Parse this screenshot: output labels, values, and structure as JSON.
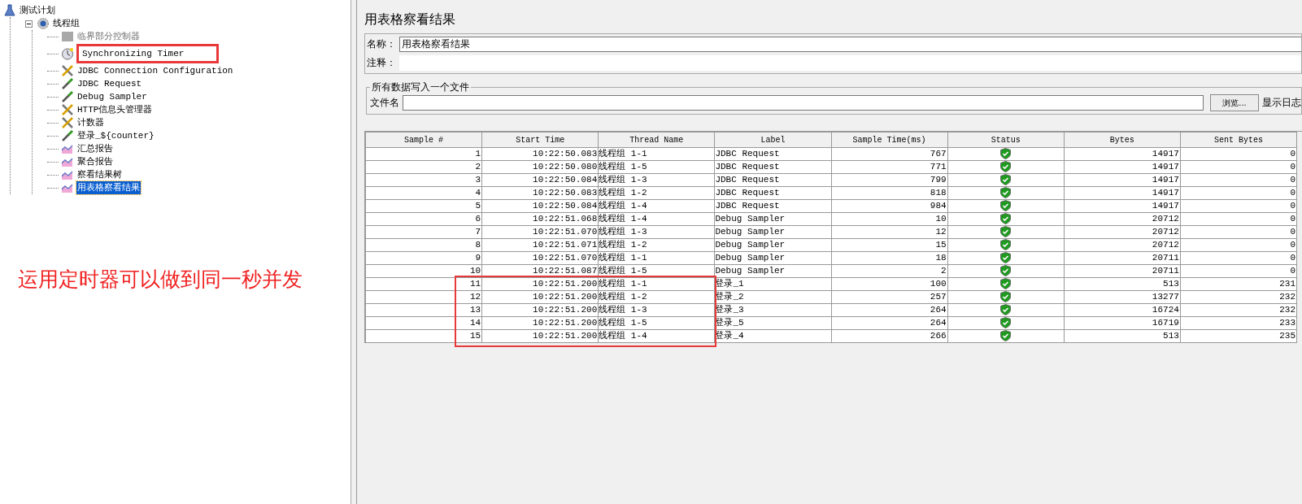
{
  "tree": [
    {
      "label": "测试计划",
      "kind": "plan",
      "children": [
        {
          "label": "线程组",
          "kind": "threadgroup",
          "expanded": true,
          "children": [
            {
              "label": "临界部分控制器",
              "kind": "controller",
              "disabled": true,
              "selected": false,
              "highlighted": false
            },
            {
              "label": "Synchronizing Timer",
              "kind": "timer",
              "disabled": false,
              "selected": false,
              "highlighted": true
            },
            {
              "label": "JDBC Connection Configuration",
              "kind": "config",
              "disabled": false,
              "selected": false,
              "highlighted": false
            },
            {
              "label": "JDBC Request",
              "kind": "sampler",
              "disabled": false,
              "selected": false,
              "highlighted": false
            },
            {
              "label": "Debug Sampler",
              "kind": "sampler",
              "disabled": false,
              "selected": false,
              "highlighted": false
            },
            {
              "label": "HTTP信息头管理器",
              "kind": "config",
              "disabled": false,
              "selected": false,
              "highlighted": false
            },
            {
              "label": "计数器",
              "kind": "config",
              "disabled": false,
              "selected": false,
              "highlighted": false
            },
            {
              "label": "登录_${counter}",
              "kind": "sampler",
              "disabled": false,
              "selected": false,
              "highlighted": false
            },
            {
              "label": "汇总报告",
              "kind": "listener",
              "disabled": false,
              "selected": false,
              "highlighted": false
            },
            {
              "label": "聚合报告",
              "kind": "listener",
              "disabled": false,
              "selected": false,
              "highlighted": false
            },
            {
              "label": "察看结果树",
              "kind": "listener",
              "disabled": false,
              "selected": false,
              "highlighted": false
            },
            {
              "label": "用表格察看结果",
              "kind": "listener",
              "disabled": false,
              "selected": true,
              "highlighted": false
            }
          ]
        }
      ]
    }
  ],
  "caption": "运用定时器可以做到同一秒并发",
  "panel": {
    "title": "用表格察看结果",
    "name_label": "名称：",
    "name_value": "用表格察看结果",
    "comment_label": "注释：",
    "file_group": {
      "title": "所有数据写入一个文件",
      "file_label": "文件名",
      "browse_button": "浏览...",
      "log_label": "显示日志"
    }
  },
  "table": {
    "columns": [
      "Sample #",
      "Start Time",
      "Thread Name",
      "Label",
      "Sample Time(ms)",
      "Status",
      "Bytes",
      "Sent Bytes"
    ],
    "rows": [
      {
        "sample": "1",
        "start": "10:22:50.083",
        "thread": "线程组 1-1",
        "label": "JDBC Request",
        "time": "767",
        "passed": true,
        "bytes": "14917",
        "sent": "0",
        "highlighted": false
      },
      {
        "sample": "2",
        "start": "10:22:50.080",
        "thread": "线程组 1-5",
        "label": "JDBC Request",
        "time": "771",
        "passed": true,
        "bytes": "14917",
        "sent": "0",
        "highlighted": false
      },
      {
        "sample": "3",
        "start": "10:22:50.084",
        "thread": "线程组 1-3",
        "label": "JDBC Request",
        "time": "799",
        "passed": true,
        "bytes": "14917",
        "sent": "0",
        "highlighted": false
      },
      {
        "sample": "4",
        "start": "10:22:50.083",
        "thread": "线程组 1-2",
        "label": "JDBC Request",
        "time": "818",
        "passed": true,
        "bytes": "14917",
        "sent": "0",
        "highlighted": false
      },
      {
        "sample": "5",
        "start": "10:22:50.084",
        "thread": "线程组 1-4",
        "label": "JDBC Request",
        "time": "984",
        "passed": true,
        "bytes": "14917",
        "sent": "0",
        "highlighted": false
      },
      {
        "sample": "6",
        "start": "10:22:51.068",
        "thread": "线程组 1-4",
        "label": "Debug Sampler",
        "time": "10",
        "passed": true,
        "bytes": "20712",
        "sent": "0",
        "highlighted": false
      },
      {
        "sample": "7",
        "start": "10:22:51.070",
        "thread": "线程组 1-3",
        "label": "Debug Sampler",
        "time": "12",
        "passed": true,
        "bytes": "20712",
        "sent": "0",
        "highlighted": false
      },
      {
        "sample": "8",
        "start": "10:22:51.071",
        "thread": "线程组 1-2",
        "label": "Debug Sampler",
        "time": "15",
        "passed": true,
        "bytes": "20712",
        "sent": "0",
        "highlighted": false
      },
      {
        "sample": "9",
        "start": "10:22:51.070",
        "thread": "线程组 1-1",
        "label": "Debug Sampler",
        "time": "18",
        "passed": true,
        "bytes": "20711",
        "sent": "0",
        "highlighted": false
      },
      {
        "sample": "10",
        "start": "10:22:51.087",
        "thread": "线程组 1-5",
        "label": "Debug Sampler",
        "time": "2",
        "passed": true,
        "bytes": "20711",
        "sent": "0",
        "highlighted": false
      },
      {
        "sample": "11",
        "start": "10:22:51.200",
        "thread": "线程组 1-1",
        "label": "登录_1",
        "time": "100",
        "passed": true,
        "bytes": "513",
        "sent": "231",
        "highlighted": true
      },
      {
        "sample": "12",
        "start": "10:22:51.200",
        "thread": "线程组 1-2",
        "label": "登录_2",
        "time": "257",
        "passed": true,
        "bytes": "13277",
        "sent": "232",
        "highlighted": true
      },
      {
        "sample": "13",
        "start": "10:22:51.200",
        "thread": "线程组 1-3",
        "label": "登录_3",
        "time": "264",
        "passed": true,
        "bytes": "16724",
        "sent": "232",
        "highlighted": true
      },
      {
        "sample": "14",
        "start": "10:22:51.200",
        "thread": "线程组 1-5",
        "label": "登录_5",
        "time": "264",
        "passed": true,
        "bytes": "16719",
        "sent": "233",
        "highlighted": true
      },
      {
        "sample": "15",
        "start": "10:22:51.200",
        "thread": "线程组 1-4",
        "label": "登录_4",
        "time": "266",
        "passed": true,
        "bytes": "513",
        "sent": "235",
        "highlighted": true
      }
    ]
  }
}
